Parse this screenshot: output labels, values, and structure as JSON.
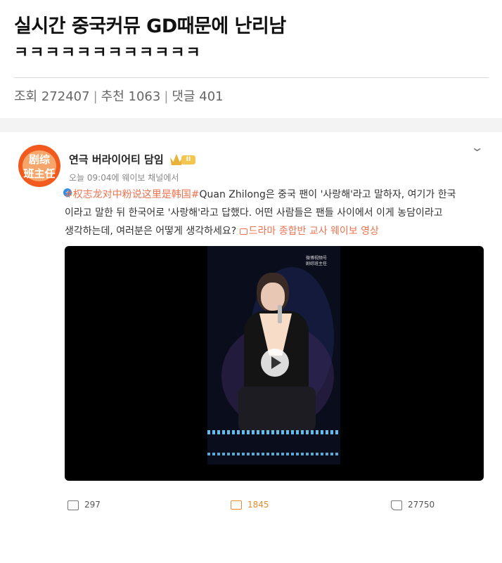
{
  "post": {
    "title_line1": "실시간 중국커뮤 GD때문에 난리남",
    "title_line2": "ㅋㅋㅋㅋㅋㅋㅋㅋㅋㅋㅋㅋ",
    "views_label": "조회",
    "views": "272407",
    "recommend_label": "추천",
    "recommend": "1063",
    "comments_label": "댓글",
    "comments": "401"
  },
  "weibo": {
    "avatar_text": "剧综\n班主任",
    "username": "연극 버라이어티 담임",
    "badge": "II",
    "subline": "오늘 09:04에 웨이보 채널에서",
    "hashtag": "#权志龙对中粉说这里是韩国#",
    "text_line1": "Quan Zhilong은 중국 팬이 '사랑해'라고 말하자, 여기가 한국",
    "text_line2": "이라고 말한 뒤 한국어로 '사랑해'라고 답했다. 어떤 사람들은 팬들 사이에서 이게 농담이라고",
    "text_line3": "생각하는데, 여러분은 어떻게 생각하세요?",
    "video_link": "드라마 종합반 교사 웨이보 영상",
    "watermark": "微博视频号\n剧综班主任",
    "shares": "297",
    "comments": "1845",
    "likes": "27750"
  },
  "colors": {
    "accent": "#eb7350",
    "comment_active": "#e58a2c",
    "verified": "#2d8de8"
  }
}
